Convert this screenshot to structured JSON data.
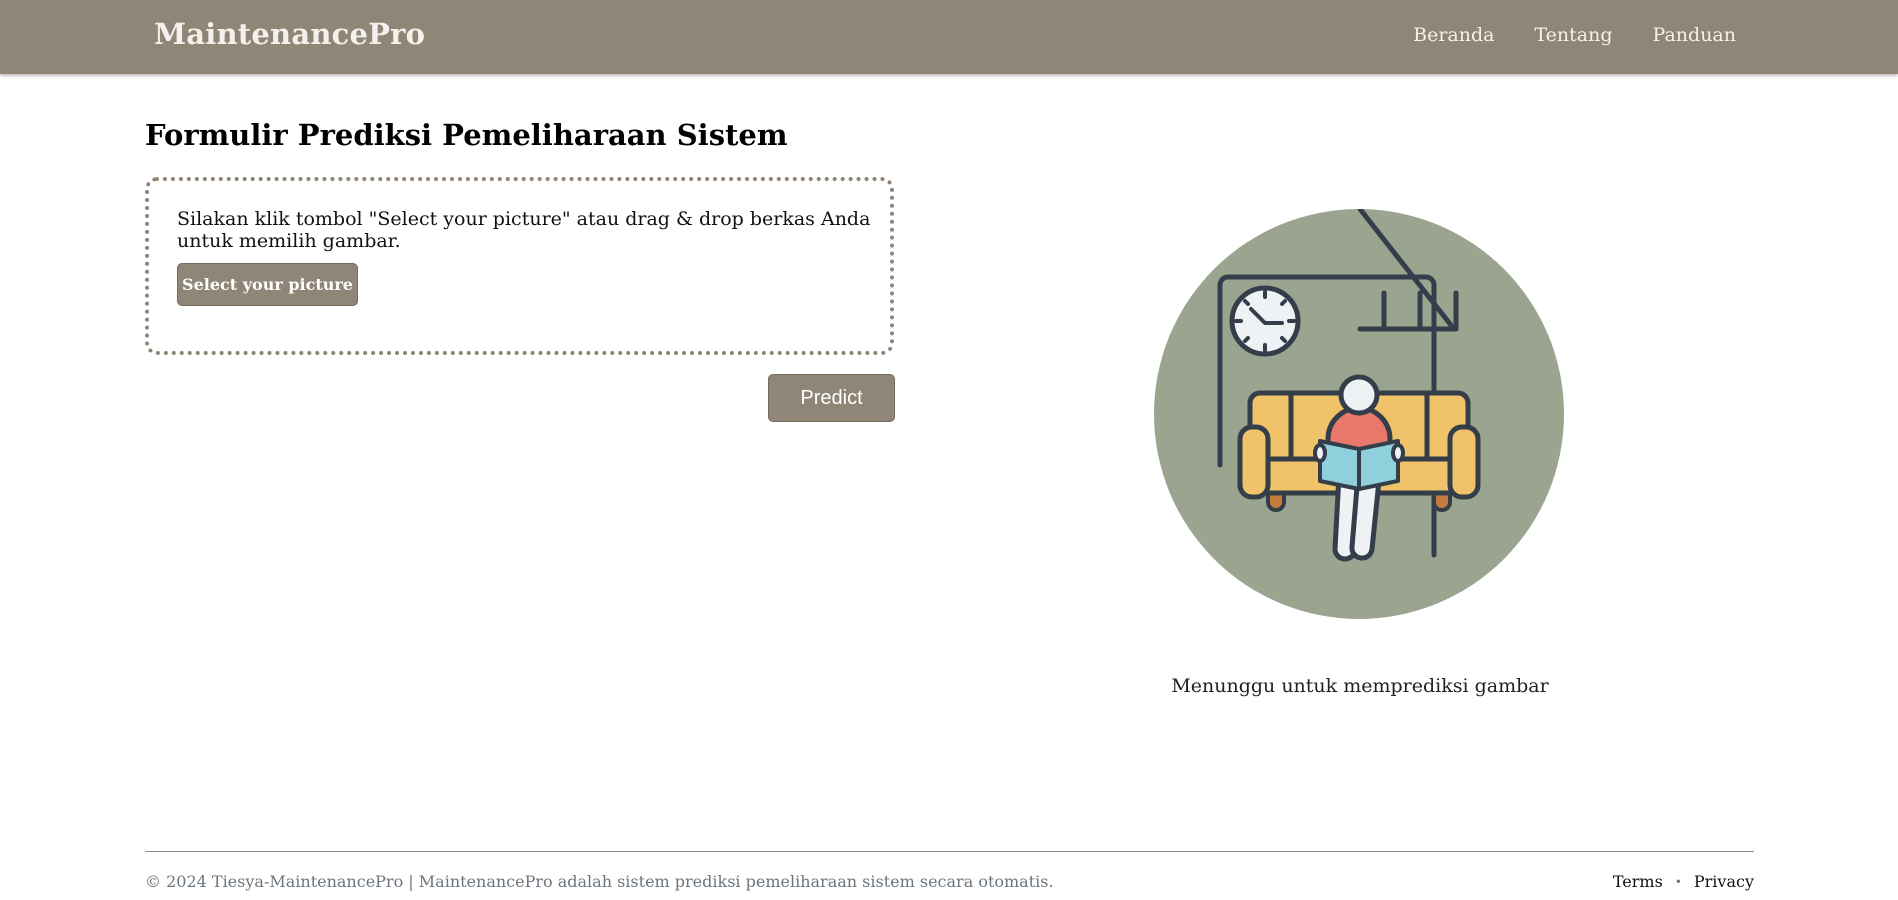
{
  "header": {
    "brand": "MaintenancePro",
    "nav": [
      {
        "label": "Beranda"
      },
      {
        "label": "Tentang"
      },
      {
        "label": "Panduan"
      }
    ]
  },
  "main": {
    "title": "Formulir Prediksi Pemeliharaan Sistem",
    "dropzone": {
      "instructions": "Silakan klik tombol \"Select your picture\" atau drag & drop berkas Anda untuk memilih gambar.",
      "select_label": "Select your picture"
    },
    "predict_label": "Predict",
    "status": "Menunggu untuk memprediksi gambar",
    "illustration_icon": "person-reading-on-sofa-icon"
  },
  "footer": {
    "copyright": "© 2024 Tiesya-MaintenancePro | MaintenancePro adalah sistem prediksi pemeliharaan sistem secara otomatis.",
    "links": [
      {
        "label": "Terms"
      },
      {
        "label": "Privacy"
      }
    ],
    "separator": "•"
  },
  "colors": {
    "navbar": "#908677",
    "button": "#908677",
    "illustration_bg": "#9aa48f",
    "sofa": "#f0c36a",
    "shirt": "#e8796a",
    "book": "#8fd0dc",
    "outline": "#333e4a"
  }
}
